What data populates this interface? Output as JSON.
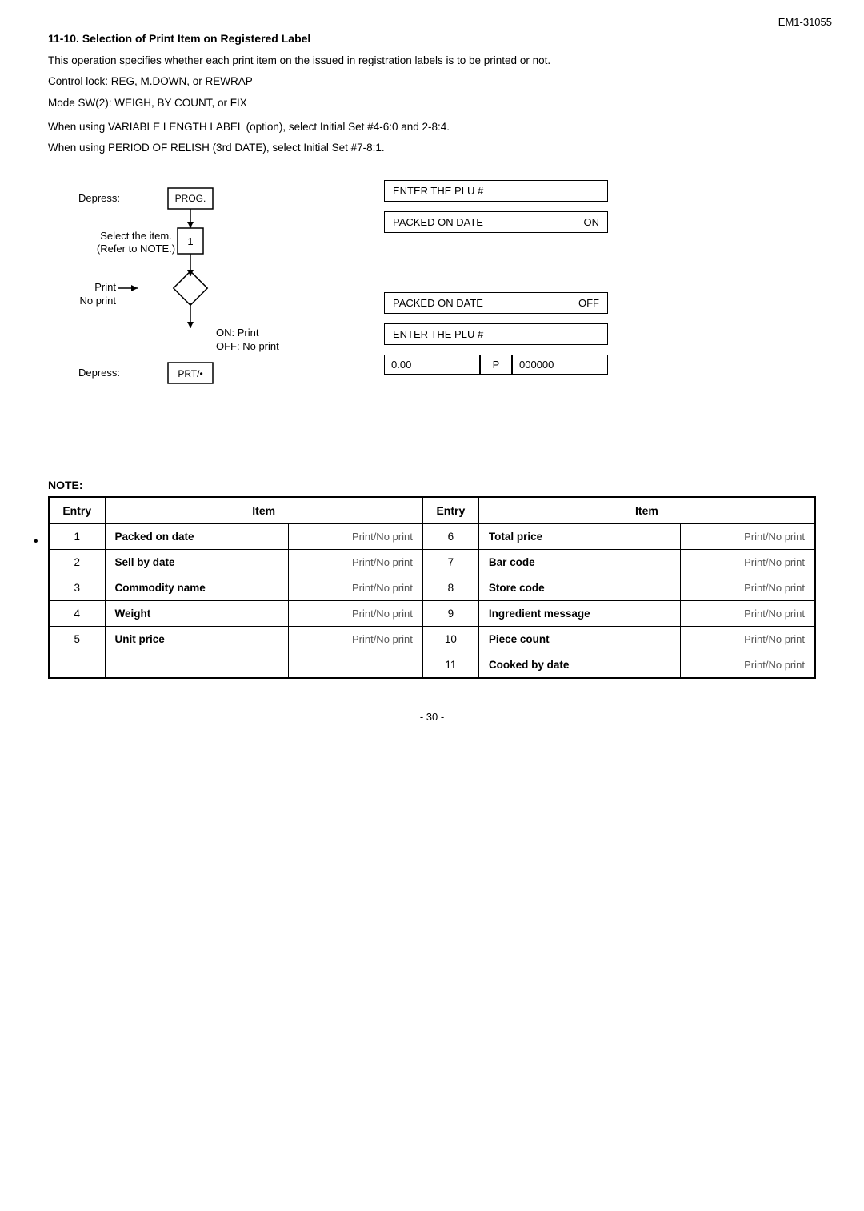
{
  "page": {
    "id": "EM1-31055",
    "page_number": "- 30 -"
  },
  "section": {
    "title": "11-10. Selection of Print Item on Registered Label",
    "paragraph1": "This operation specifies whether each print item on the issued in registration labels is to be printed or not.",
    "control_lock": "Control lock: REG, M.DOWN, or REWRAP",
    "mode_sw": "Mode SW(2): WEIGH, BY COUNT, or FIX",
    "variable_label": "When using VARIABLE LENGTH LABEL (option), select Initial Set #4-6:0 and 2-8:4.",
    "period_label": "When using PERIOD OF RELISH (3rd DATE), select Initial Set #7-8:1."
  },
  "diagram": {
    "depress1_label": "Depress:",
    "prog_button": "PROG.",
    "select_item_label": "Select the item.",
    "refer_note": "(Refer to NOTE.)",
    "step1_button": "1",
    "print_label": "Print → No print",
    "diamond_label": "◊",
    "on_label": "ON: Print",
    "off_label": "OFF: No print",
    "depress2_label": "Depress:",
    "prt_button": "PRT/•",
    "display_boxes": [
      {
        "label": "ENTER THE PLU #",
        "value": ""
      },
      {
        "label": "PACKED ON DATE",
        "value": "ON"
      },
      {
        "label": "PACKED ON DATE",
        "value": "OFF"
      },
      {
        "label": "ENTER THE PLU #",
        "value": ""
      }
    ],
    "bottom_row": [
      {
        "value": "0.00"
      },
      {
        "value": "P"
      },
      {
        "value": "000000"
      }
    ]
  },
  "note": {
    "label": "NOTE:",
    "columns": [
      "Entry",
      "Item",
      "Entry",
      "Item"
    ],
    "rows_left": [
      {
        "entry": "1",
        "item": "Packed on date",
        "print": "Print/No print"
      },
      {
        "entry": "2",
        "item": "Sell by date",
        "print": "Print/No print"
      },
      {
        "entry": "3",
        "item": "Commodity name",
        "print": "Print/No print"
      },
      {
        "entry": "4",
        "item": "Weight",
        "print": "Print/No print"
      },
      {
        "entry": "5",
        "item": "Unit price",
        "print": "Print/No print"
      }
    ],
    "rows_right": [
      {
        "entry": "6",
        "item": "Total price",
        "print": "Print/No print"
      },
      {
        "entry": "7",
        "item": "Bar code",
        "print": "Print/No print"
      },
      {
        "entry": "8",
        "item": "Store code",
        "print": "Print/No print"
      },
      {
        "entry": "9",
        "item": "Ingredient message",
        "print": "Print/No print"
      },
      {
        "entry": "10",
        "item": "Piece count",
        "print": "Print/No print"
      },
      {
        "entry": "11",
        "item": "Cooked by date",
        "print": "Print/No print"
      }
    ]
  }
}
